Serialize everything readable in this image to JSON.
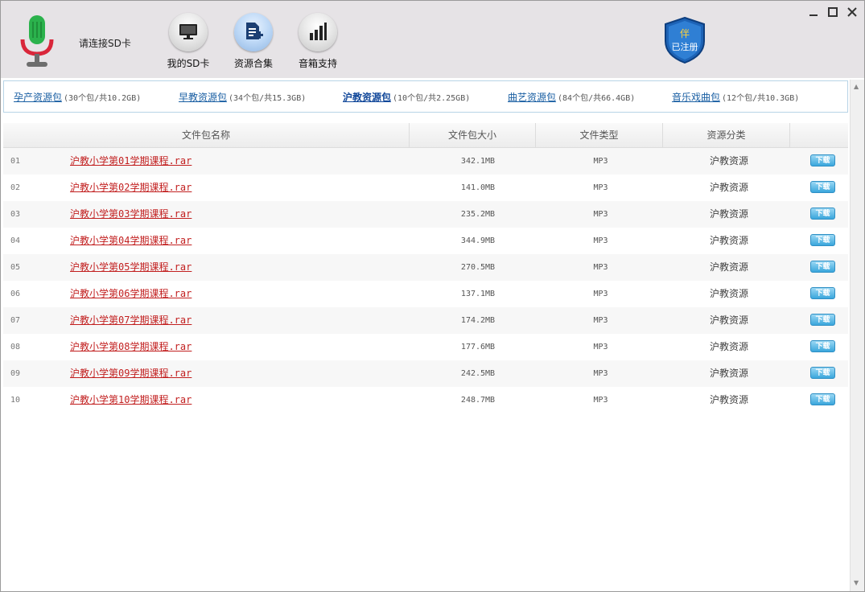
{
  "header": {
    "sd_status": "请连接SD卡",
    "tools": [
      {
        "label": "我的SD卡",
        "icon": "monitor-icon"
      },
      {
        "label": "资源合集",
        "icon": "document-add-icon"
      },
      {
        "label": "音箱支持",
        "icon": "bar-chart-icon"
      }
    ],
    "badge": {
      "top": "伴",
      "bottom": "已注册",
      "icon": "registered-shield-icon"
    },
    "window_controls": [
      "minimize-icon",
      "maximize-icon",
      "close-icon"
    ]
  },
  "categories": [
    {
      "name": "孕产资源包",
      "info": "(30个包/共10.2GB)"
    },
    {
      "name": "早教资源包",
      "info": "(34个包/共15.3GB)"
    },
    {
      "name": "沪教资源包",
      "info": "(10个包/共2.25GB)",
      "active": true
    },
    {
      "name": "曲艺资源包",
      "info": "(84个包/共66.4GB)"
    },
    {
      "name": "音乐戏曲包",
      "info": "(12个包/共10.3GB)"
    }
  ],
  "table": {
    "columns": [
      "文件包名称",
      "文件包大小",
      "文件类型",
      "资源分类"
    ],
    "download_label": "下载",
    "rows": [
      {
        "num": "01",
        "name": "沪教小学第01学期课程.rar",
        "size": "342.1MB",
        "type": "MP3",
        "category": "沪教资源"
      },
      {
        "num": "02",
        "name": "沪教小学第02学期课程.rar",
        "size": "141.0MB",
        "type": "MP3",
        "category": "沪教资源"
      },
      {
        "num": "03",
        "name": "沪教小学第03学期课程.rar",
        "size": "235.2MB",
        "type": "MP3",
        "category": "沪教资源"
      },
      {
        "num": "04",
        "name": "沪教小学第04学期课程.rar",
        "size": "344.9MB",
        "type": "MP3",
        "category": "沪教资源"
      },
      {
        "num": "05",
        "name": "沪教小学第05学期课程.rar",
        "size": "270.5MB",
        "type": "MP3",
        "category": "沪教资源"
      },
      {
        "num": "06",
        "name": "沪教小学第06学期课程.rar",
        "size": "137.1MB",
        "type": "MP3",
        "category": "沪教资源"
      },
      {
        "num": "07",
        "name": "沪教小学第07学期课程.rar",
        "size": "174.2MB",
        "type": "MP3",
        "category": "沪教资源"
      },
      {
        "num": "08",
        "name": "沪教小学第08学期课程.rar",
        "size": "177.6MB",
        "type": "MP3",
        "category": "沪教资源"
      },
      {
        "num": "09",
        "name": "沪教小学第09学期课程.rar",
        "size": "242.5MB",
        "type": "MP3",
        "category": "沪教资源"
      },
      {
        "num": "10",
        "name": "沪教小学第10学期课程.rar",
        "size": "248.7MB",
        "type": "MP3",
        "category": "沪教资源"
      }
    ]
  },
  "colors": {
    "header_bg": "#e6e3e6",
    "link_blue": "#1a5fa3",
    "file_red": "#c22020",
    "download_blue": "#3aa6dc",
    "mic_green": "#2bb24c",
    "mic_red": "#d9263a"
  }
}
